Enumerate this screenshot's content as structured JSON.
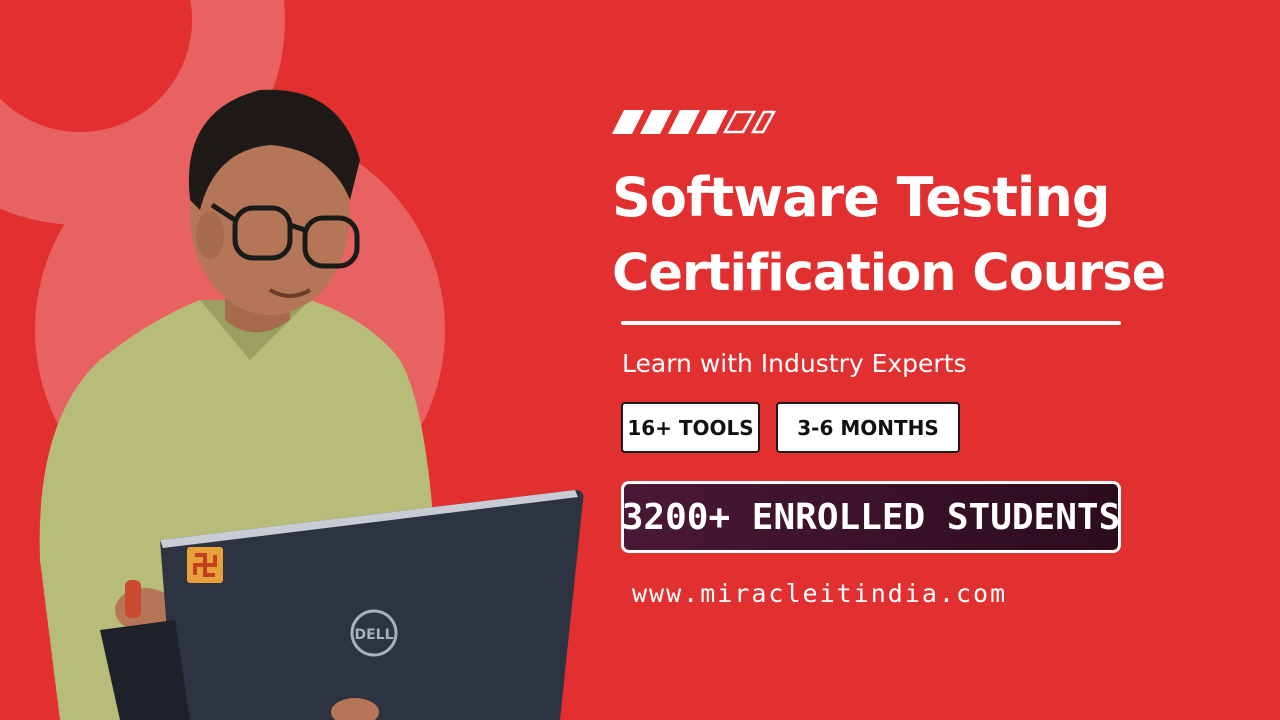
{
  "colors": {
    "background": "#e22f2f",
    "circle_light": "#e96262",
    "text": "#ffffff",
    "banner_start": "#4a1836",
    "banner_end": "#2b0c1d",
    "pill_text": "#111111"
  },
  "decor": {
    "stripes_icon": "diagonal-stripes-icon",
    "filled_stripes": 4,
    "outlined_stripes": 2
  },
  "hero": {
    "title_line1": "Software Testing",
    "title_line2": "Certification Course",
    "subtitle": "Learn with Industry Experts"
  },
  "badges": {
    "tools": "16+ TOOLS",
    "duration": "3-6 MONTHS"
  },
  "banner": {
    "text": "3200+ ENROLLED STUDENTS"
  },
  "footer": {
    "url": "www.miracleitindia.com"
  },
  "photo": {
    "laptop_brand": "DELL",
    "laptop_sticker_icon": "swastika-sticker-icon"
  }
}
